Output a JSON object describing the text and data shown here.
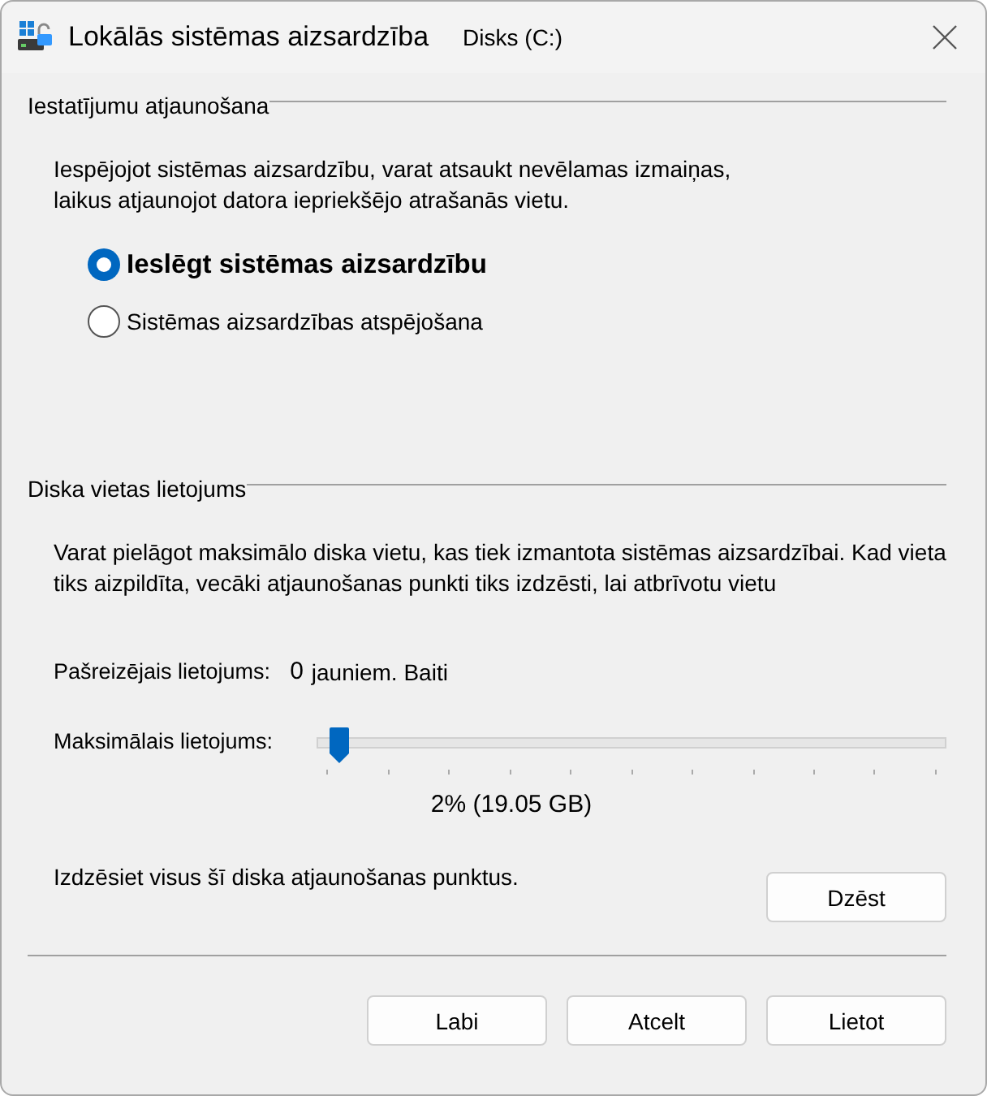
{
  "window": {
    "title": "Lokālās sistēmas aizsardzība",
    "subtitle": "Disks (C:)"
  },
  "restore_settings": {
    "heading": "Iestatījumu atjaunošana",
    "description_lines": [
      "Iespējojot sistēmas aizsardzību, varat atsaukt nevēlamas izmaiņas,",
      "laikus atjaunojot datora iepriekšējo atrašanās vietu."
    ],
    "options": [
      {
        "label": "Ieslēgt sistēmas aizsardzību",
        "selected": true
      },
      {
        "label": "Sistēmas aizsardzības atspējošana",
        "selected": false
      }
    ]
  },
  "disk_usage": {
    "heading": "Diska vietas lietojums",
    "description_lines": [
      "Varat pielāgot maksimālo diska vietu, kas tiek izmantota sistēmas aizsardzībai. Kad vieta",
      "tiks aizpildīta, vecāki atjaunošanas punkti tiks izdzēsti, lai atbrīvotu vietu"
    ],
    "current_label": "Pašreizējais lietojums:",
    "current_value": "0",
    "current_unit": "jauniem. Baiti",
    "max_label": "Maksimālais lietojums:",
    "max_slider": {
      "level": 0.02
    },
    "max_reading": "2% (19.05 GB)",
    "delete_text": "Izdzēsiet visus šī diska atjaunošanas punktus.",
    "delete_button": "Dzēst"
  },
  "buttons": [
    "Labi",
    "Atcelt",
    "Lietot"
  ]
}
